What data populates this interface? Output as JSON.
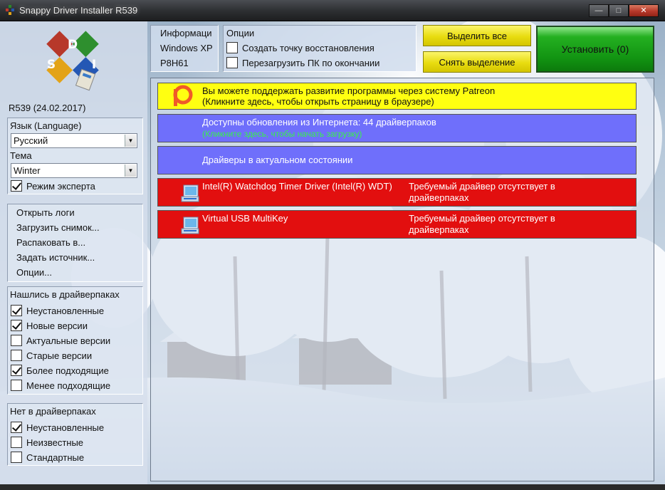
{
  "window": {
    "title": "Snappy Driver Installer R539"
  },
  "left": {
    "version": "R539 (24.02.2017)",
    "language_label": "Язык (Language)",
    "language_value": "Русский",
    "theme_label": "Тема",
    "theme_value": "Winter",
    "expert_mode": {
      "label": "Режим эксперта",
      "checked": true
    },
    "menu": [
      "Открыть логи",
      "Загрузить снимок...",
      "Распаковать в...",
      "Задать источник...",
      "Опции..."
    ],
    "found_title": "Нашлись в драйверпаках",
    "found": [
      {
        "label": "Неустановленные",
        "checked": true
      },
      {
        "label": "Новые версии",
        "checked": true
      },
      {
        "label": "Актуальные версии",
        "checked": false
      },
      {
        "label": "Старые версии",
        "checked": false
      },
      {
        "label": "Более подходящие",
        "checked": true
      },
      {
        "label": "Менее подходящие",
        "checked": false
      }
    ],
    "notfound_title": "Нет в драйверпаках",
    "notfound": [
      {
        "label": "Неустановленные",
        "checked": true
      },
      {
        "label": "Неизвестные",
        "checked": false
      },
      {
        "label": "Стандартные",
        "checked": false
      }
    ]
  },
  "header": {
    "info_title": "Информаци",
    "os": "Windows XP",
    "board": "P8H61",
    "options_title": "Опции",
    "opt_restore": {
      "label": "Создать точку восстановления",
      "checked": false
    },
    "opt_reboot": {
      "label": "Перезагрузить ПК по окончании",
      "checked": false
    },
    "select_all": "Выделить все",
    "deselect": "Снять выделение",
    "install": "Установить (0)"
  },
  "list": {
    "patreon_line1": "Вы можете поддержать развитие программы через систему Patreon",
    "patreon_line2": "(Кликните здесь, чтобы открыть страницу в браузере)",
    "updates_line1": "Доступны обновления из Интернета: 44 драйверпаков",
    "updates_line2": "(Кликните здесь, чтобы начать загрузку)",
    "uptodate": "Драйверы в актуальном состоянии",
    "drivers": [
      {
        "name": "Intel(R) Watchdog Timer Driver (Intel(R) WDT)",
        "status": "Требуемый драйвер отсутствует в драйверпаках"
      },
      {
        "name": "Virtual USB MultiKey",
        "status": "Требуемый драйвер отсутствует в драйверпаках"
      }
    ]
  },
  "colors": {
    "patreon_row": "#ffff11",
    "info_row": "#6f6ffb",
    "missing_row": "#e20f0f",
    "install_button": "#129412",
    "select_buttons": "#e8dc10"
  },
  "icons": {
    "app": "sdi-logo-icon",
    "patreon": "patreon-icon",
    "device": "computer-monitor-icon",
    "dropdown": "chevron-down-icon",
    "window_controls": [
      "minimize-icon",
      "maximize-icon",
      "close-icon"
    ]
  }
}
